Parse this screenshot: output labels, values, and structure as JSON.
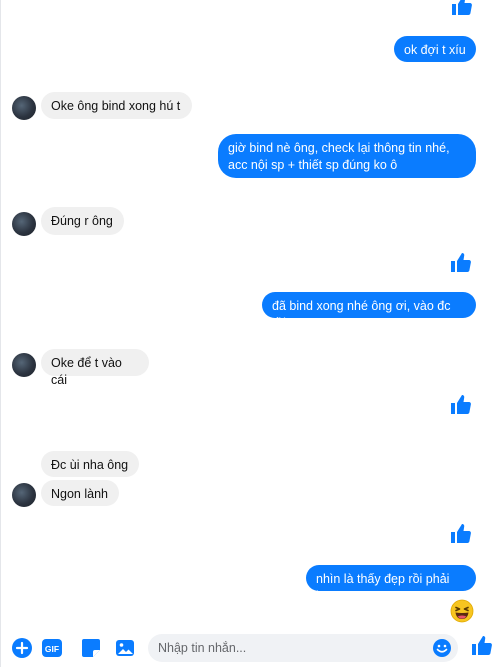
{
  "conversation": {
    "messages": [
      {
        "dir": "out",
        "text": "ok đợi t xíu"
      },
      {
        "dir": "in",
        "text": "Oke ông bind xong hú t"
      },
      {
        "dir": "out",
        "text": "giờ bind nè ông, check lại thông tin nhé,\nacc nội sp + thiết sp đúng ko ô"
      },
      {
        "dir": "in",
        "text": "Đúng r ông"
      },
      {
        "dir": "out",
        "text": "đã bind xong nhé ông ơi, vào đc rồi"
      },
      {
        "dir": "in",
        "text": "Oke để t vào cái"
      },
      {
        "dir": "in",
        "text": "Đc ùi nha ông"
      },
      {
        "dir": "in",
        "text": "Ngon lành"
      },
      {
        "dir": "out",
        "text": "nhìn là thấy đẹp rồi phải ko"
      }
    ]
  },
  "composer": {
    "placeholder": "Nhập tin nhắn...",
    "value": "",
    "gif_label": "GIF"
  },
  "colors": {
    "accent": "#0a7cff",
    "incoming_bubble": "#f0f0f0",
    "emoji_yellow": "#f7c520"
  },
  "icons": [
    "thumbs-up-icon",
    "laughing-emoji-icon",
    "plus-circle-icon",
    "gif-icon",
    "sticker-icon",
    "image-icon",
    "smiley-icon"
  ]
}
